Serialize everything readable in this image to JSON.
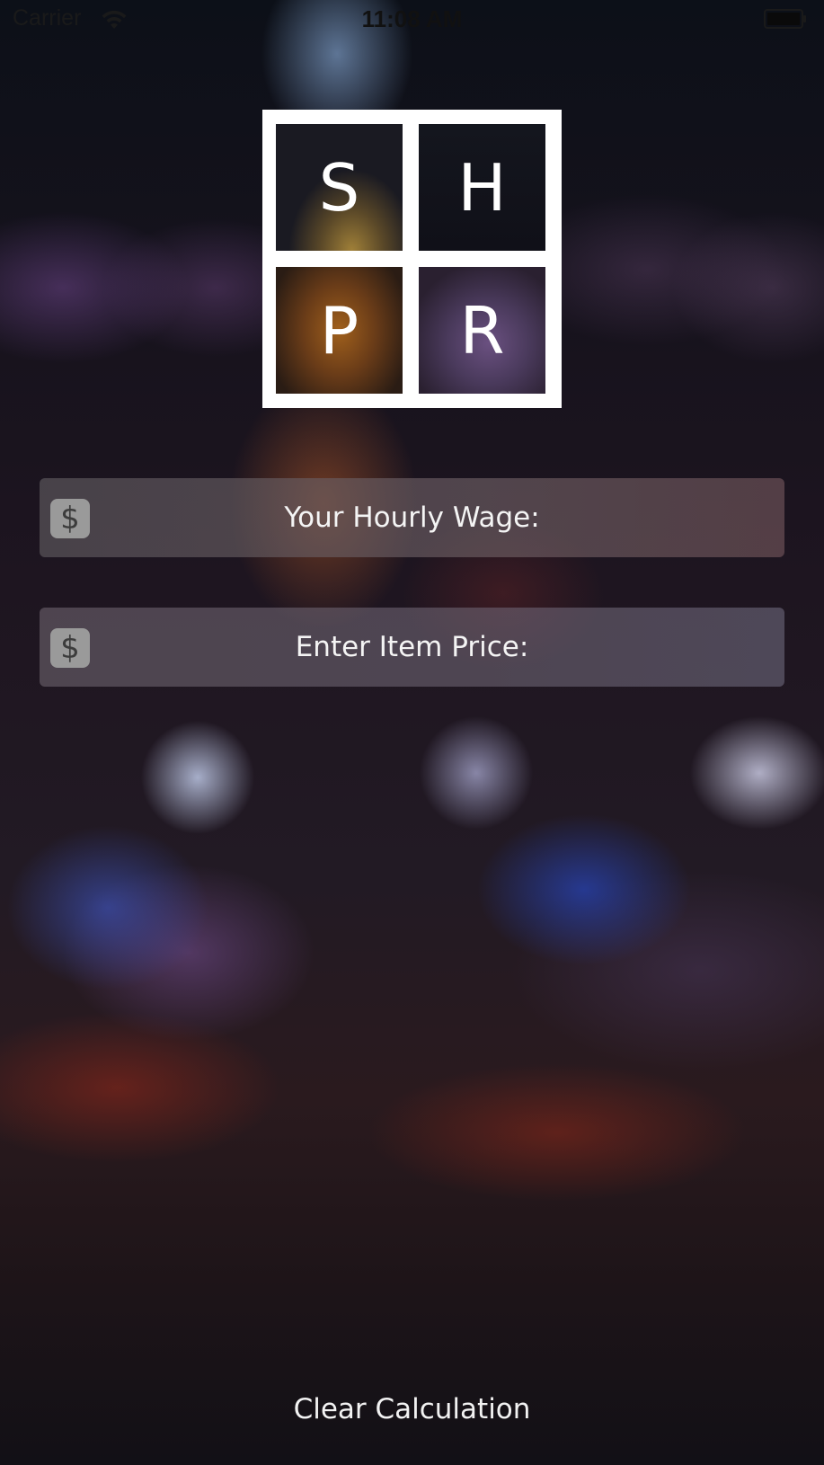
{
  "status_bar": {
    "carrier": "Carrier",
    "time": "11:08 AM",
    "wifi_icon": "wifi-icon",
    "battery_icon": "battery-icon"
  },
  "logo": {
    "tiles": [
      "S",
      "H",
      "P",
      "R"
    ]
  },
  "fields": {
    "wage": {
      "placeholder": "Your Hourly Wage:",
      "value": "",
      "icon_label": "$"
    },
    "price": {
      "placeholder": "Enter Item Price:",
      "value": "",
      "icon_label": "$"
    }
  },
  "actions": {
    "clear_label": "Clear Calculation"
  },
  "colors": {
    "text": "#ffffff",
    "logo_background": "#ffffff",
    "dollar_badge": "#9a9a9a"
  }
}
